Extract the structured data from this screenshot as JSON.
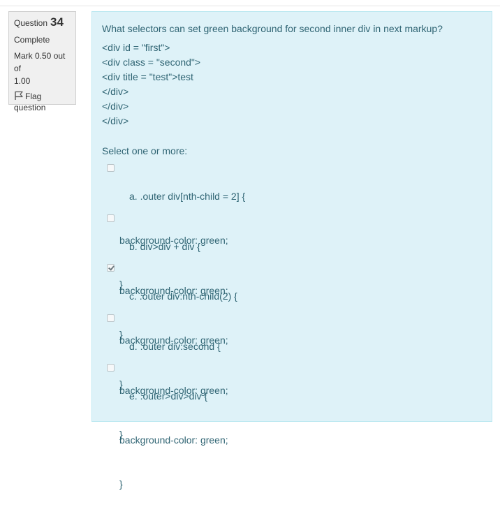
{
  "info": {
    "question_label": "Question",
    "question_number": "34",
    "state": "Complete",
    "mark_line1": "Mark 0.50 out of",
    "mark_line2": "1.00",
    "flag_line1": "Flag",
    "flag_line2": "question",
    "flag_icon": "flag-icon"
  },
  "question": {
    "text": "What selectors can set green background for second inner div in next markup?",
    "markup_lines": [
      "<div id = \"first\">",
      "<div class = \"second\">",
      "<div title = \"test\">test",
      "</div>",
      "</div>",
      "</div>"
    ],
    "prompt": "Select one or more:",
    "options": [
      {
        "letter": "a.",
        "line1": ".outer div[nth-child = 2] {",
        "line2": "background-color: green;",
        "line3": "}",
        "checked": false
      },
      {
        "letter": "b.",
        "line1": "div>div + div {",
        "line2": "background-color: green;",
        "line3": "}",
        "checked": false
      },
      {
        "letter": "c.",
        "line1": ".outer div:nth-child(2) {",
        "line2": "background-color: green;",
        "line3": "}",
        "checked": true
      },
      {
        "letter": "d.",
        "line1": ".outer div:second {",
        "line2": "background-color: green;",
        "line3": "}",
        "checked": false
      },
      {
        "letter": "e.",
        "line1": ".outer>div>div {",
        "line2": "background-color: green;",
        "line3": "}",
        "checked": false
      }
    ]
  },
  "colors": {
    "panel_bg": "#def2f8",
    "panel_border": "#bce8f1",
    "panel_text": "#2f6473",
    "info_bg": "#f0f0f0"
  }
}
